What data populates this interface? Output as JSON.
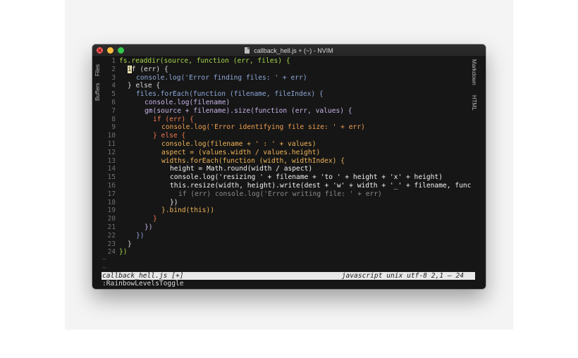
{
  "window": {
    "title": "callback_hell.js + (~) - NVIM",
    "file_icon": "document-icon"
  },
  "side_tabs": {
    "left": [
      "Files",
      "Buffers"
    ],
    "right": [
      "Markdown",
      "HTML"
    ]
  },
  "editor": {
    "cursor_char": "i",
    "lines": [
      {
        "n": "1",
        "indent": 0,
        "color": "#a8d64a",
        "text": "fs.readdir(source, function (err, files) {"
      },
      {
        "n": "2",
        "indent": 1,
        "color": "#dcdcdc",
        "text": "f (err) {",
        "cursor": true
      },
      {
        "n": "3",
        "indent": 2,
        "color": "#8fa8d8",
        "text": "console.log('Error finding files: ' + err)"
      },
      {
        "n": "4",
        "indent": 1,
        "color": "#dcdcdc",
        "text": "} else {"
      },
      {
        "n": "5",
        "indent": 2,
        "color": "#8fa8d8",
        "text": "files.forEach(function (filename, fileIndex) {"
      },
      {
        "n": "6",
        "indent": 3,
        "color": "#c7b4e8",
        "text": "console.log(filename)"
      },
      {
        "n": "7",
        "indent": 3,
        "color": "#c7b4e8",
        "text": "gm(source + filename).size(function (err, values) {"
      },
      {
        "n": "8",
        "indent": 4,
        "color": "#f07850",
        "text": "if (err) {"
      },
      {
        "n": "9",
        "indent": 5,
        "color": "#f0a050",
        "text": "console.log('Error identifying file size: ' + err)"
      },
      {
        "n": "10",
        "indent": 4,
        "color": "#f07850",
        "text": "} else {"
      },
      {
        "n": "11",
        "indent": 5,
        "color": "#f0b458",
        "text": "console.log(filename + ' : ' + values)"
      },
      {
        "n": "12",
        "indent": 5,
        "color": "#f0b458",
        "text": "aspect = (values.width / values.height)"
      },
      {
        "n": "13",
        "indent": 5,
        "color": "#f0b458",
        "text": "widths.forEach(function (width, widthIndex) {"
      },
      {
        "n": "14",
        "indent": 6,
        "color": "#f2f2f2",
        "text": "height = Math.round(width / aspect)"
      },
      {
        "n": "15",
        "indent": 6,
        "color": "#f2f2f2",
        "text": "console.log('resizing ' + filename + 'to ' + height + 'x' + height)"
      },
      {
        "n": "16",
        "indent": 6,
        "color": "#f2f2f2",
        "text": "this.resize(width, height).write(dest + 'w' + width + '_' + filename, func"
      },
      {
        "n": "17",
        "indent": 7,
        "color": "#8c8c8c",
        "text": "if (err) console.log('Error writing file: ' + err)"
      },
      {
        "n": "18",
        "indent": 6,
        "color": "#f2f2f2",
        "text": "})"
      },
      {
        "n": "19",
        "indent": 5,
        "color": "#f0b458",
        "text": "}.bind(this))"
      },
      {
        "n": "20",
        "indent": 4,
        "color": "#f07850",
        "text": "}"
      },
      {
        "n": "21",
        "indent": 3,
        "color": "#c7b4e8",
        "text": "})"
      },
      {
        "n": "22",
        "indent": 2,
        "color": "#8fa8d8",
        "text": "})"
      },
      {
        "n": "23",
        "indent": 1,
        "color": "#dcdcdc",
        "text": "}"
      },
      {
        "n": "24",
        "indent": 0,
        "color": "#a8d64a",
        "text": "})"
      }
    ],
    "empty_marker": "~"
  },
  "statusline": {
    "file": "callback_hell.js [+]",
    "info": "javascript unix utf-8 2,1 – 24"
  },
  "cmdline": {
    "text": ":RainbowLevelsToggle"
  }
}
